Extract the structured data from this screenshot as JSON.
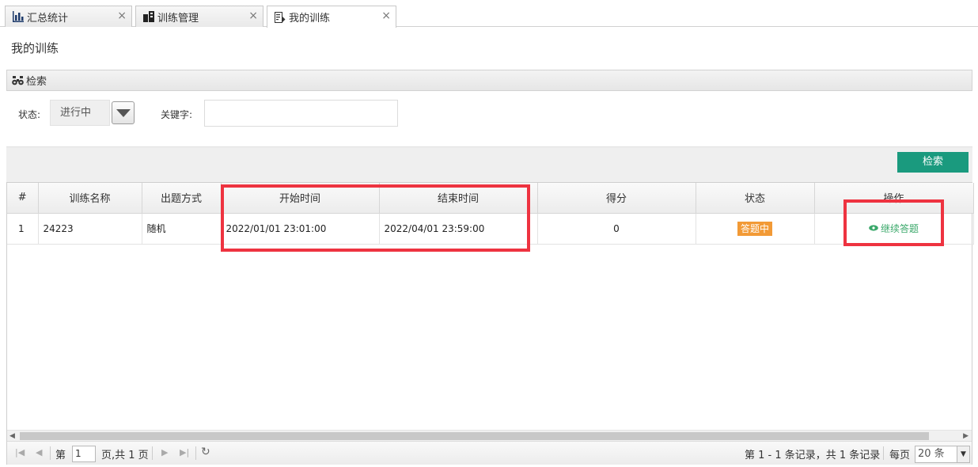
{
  "tabs": [
    {
      "label": "汇总统计",
      "icon": "bar-chart-icon",
      "close": "×"
    },
    {
      "label": "训练管理",
      "icon": "training-manage-icon",
      "close": "×"
    },
    {
      "label": "我的训练",
      "icon": "my-training-icon",
      "close": "×"
    }
  ],
  "page_title": "我的训练",
  "search_panel": {
    "header": "检索",
    "status_label": "状态:",
    "status_value": "进行中",
    "keyword_label": "关键字:",
    "keyword_value": "",
    "search_button": "检索"
  },
  "table": {
    "headers": [
      "#",
      "训练名称",
      "出题方式",
      "开始时间",
      "结束时间",
      "得分",
      "状态",
      "操作"
    ],
    "rows": [
      {
        "index": "1",
        "name": "24223",
        "mode": "随机",
        "start": "2022/01/01 23:01:00",
        "end": "2022/04/01 23:59:00",
        "score": "0",
        "status": "答题中",
        "action": "继续答题"
      }
    ]
  },
  "pager": {
    "page_prefix": "第",
    "page_value": "1",
    "page_suffix": "页,共 1 页",
    "summary": "第 1 - 1 条记录，共 1 条记录",
    "per_page_label": "每页",
    "per_page_value": "20 条"
  },
  "colors": {
    "accent": "#1a9a7e",
    "badge": "#f29a36",
    "link": "#3aa86a",
    "highlight": "#ee3340"
  }
}
